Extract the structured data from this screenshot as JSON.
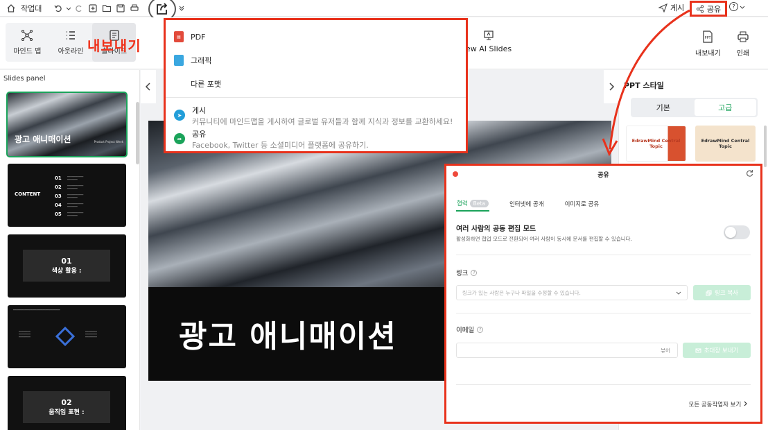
{
  "topbar": {
    "workspace_label": "작업대",
    "post_label": "게시",
    "share_label": "공유",
    "help_label": "?"
  },
  "toolrow": {
    "views": [
      {
        "label": "마인드 맵",
        "icon": "mindmap-icon"
      },
      {
        "label": "아웃라인",
        "icon": "outline-icon"
      },
      {
        "label": "슬라이드",
        "icon": "slides-icon"
      }
    ],
    "active_view": "슬라이드",
    "export_callout": "내보내기",
    "ai_slides_label": "ew AI Slides",
    "export_label": "내보내기",
    "print_label": "인쇄"
  },
  "slides_panel": {
    "title": "Slides panel",
    "thumbs": [
      {
        "title": "광고 애니매이션",
        "sub": "Product Project Week"
      },
      {
        "content_label": "CONTENT",
        "items": [
          "01",
          "02",
          "03",
          "04",
          "05"
        ]
      },
      {
        "num": "01",
        "text": "색상 활용 :"
      },
      {
        "kind": "diamond"
      },
      {
        "num": "02",
        "text": "움직임 표현 :"
      }
    ]
  },
  "canvas": {
    "slide_title": "광고 애니매이션"
  },
  "right_panel": {
    "title": "PPT 스타일",
    "seg_basic": "기본",
    "seg_advanced": "고급",
    "card1": "EdrawMind Central Topic",
    "card2": "EdrawMind Central Topic"
  },
  "export_menu": {
    "pdf": "PDF",
    "graphic": "그래픽",
    "other_format": "다른 포맷",
    "post_title": "게시",
    "post_desc": "커뮤니티에 마인드맵을 게시하여 글로벌 유저들과 함께 지식과 정보를 교환하세요!",
    "share_title": "공유",
    "share_desc": "Facebook, Twitter 등 소셜미디어 플랫폼에 공유하기."
  },
  "share_dialog": {
    "title": "공유",
    "tabs": [
      "협력",
      "인터넷에 공개",
      "이미지로 공유"
    ],
    "beta": "Beta",
    "coedit_title": "여러 사람의 공동 편집 모드",
    "coedit_desc": "활성화하면 협업 모드로 전환되어 여러 사람이 동시에 문서를 편집할 수 있습니다.",
    "link_label": "링크",
    "link_placeholder": "링크가 있는 사람은 누구나 파일을 수정할 수 있습니다.",
    "copy_link": "링크 복사",
    "email_label": "이메일",
    "email_role": "뷰어",
    "send_invite": "초대장 보내기",
    "all_collab": "모든 공동작업자 보기",
    "coedit_enabled": false
  },
  "colors": {
    "accent": "#1aa35a",
    "highlight": "#e8321c"
  }
}
